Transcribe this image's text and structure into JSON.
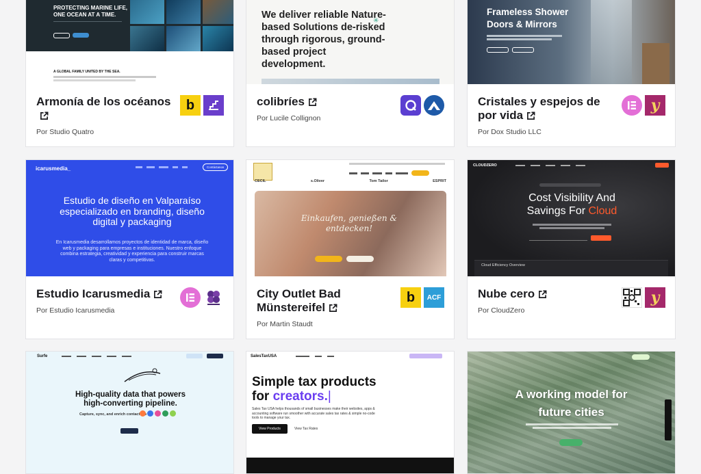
{
  "cards": [
    {
      "title": "Armonía de los océanos",
      "by": "Por Studio Quatro",
      "thumb": {
        "headline_1": "PROTECTING MARINE LIFE,",
        "headline_2": "ONE OCEAN AT A TIME.",
        "subline": "A GLOBAL FAMILY UNITED BY THE SEA."
      },
      "logos": [
        "b",
        "stairs-icon"
      ]
    },
    {
      "title": "colibríes",
      "by": "Por Lucile Collignon",
      "thumb": {
        "headline": "We deliver reliable Nature-based Solutions de-risked through rigorous, ground-based project development."
      },
      "logos": [
        "q-ring-icon",
        "mountain-icon"
      ]
    },
    {
      "title": "Cristales y espejos de por vida",
      "by": "Por Dox Studio LLC",
      "thumb": {
        "headline": "Frameless Shower Doors & Mirrors"
      },
      "logos": [
        "elementor-icon",
        "yoast-icon"
      ]
    },
    {
      "title": "Estudio Icarusmedia",
      "by": "Por Estudio Icarusmedia",
      "thumb": {
        "brand": "icarusmedia_",
        "nav_cta": "Contáctanos",
        "headline": "Estudio de diseño en Valparaíso especializado en branding, diseño digital y packaging",
        "body": "En Icarusmedia desarrollamos proyectos de identidad de marca, diseño web y packaging para empresas e instituciones. Nuestro enfoque combina estrategia, creatividad y experiencia para construir marcas claras y competitivas."
      },
      "logos": [
        "elementor-icon",
        "duplicator-icon"
      ]
    },
    {
      "title": "City Outlet Bad Münstereifel",
      "by": "Por Martin Staudt",
      "thumb": {
        "script_1": "Einkaufen, genießen &",
        "script_2": "entdecken!",
        "brands": [
          "CECIL",
          "s.Oliver",
          "Tom Tailor",
          "ESPRIT"
        ]
      },
      "logos": [
        "b",
        "ACF"
      ]
    },
    {
      "title": "Nube cero",
      "by": "Por CloudZero",
      "thumb": {
        "brand": "CLOUDZERO",
        "headline_1": "Cost Visibility And",
        "headline_2": "Savings For",
        "accent_word": "Cloud",
        "panel_label": "Cloud Efficiency Overview"
      },
      "logos": [
        "qr-icon",
        "yoast-icon"
      ]
    },
    {
      "thumb": {
        "brand": "Surfe",
        "headline_1": "High-quality data that powers",
        "headline_2": "high-converting pipeline.",
        "subline": "Capture, sync, and enrich contacts to"
      }
    },
    {
      "thumb": {
        "brand": "SalesTaxUSA",
        "headline_1": "Simple tax products",
        "headline_2a": "for",
        "headline_2b": "creators.",
        "body": "Sales Tax USA helps thousands of small businesses make their websites, apps & accounting software run smoother with accurate sales tax rates & simple no-code tools to manage your tax.",
        "btn_primary": "View Products",
        "btn_secondary": "View Tax Rates"
      }
    },
    {
      "thumb": {
        "headline_1": "A working model for",
        "headline_2": "future cities"
      }
    }
  ],
  "colors": {
    "accent_blue": "#2d5bff",
    "icarus_blue": "#2f4de8",
    "cloud_orange": "#ff5a2c",
    "tax_purple": "#6a3df0",
    "elementor_pink": "#e36fd6",
    "yoast_purple": "#a4286a",
    "b_yellow": "#f7d010"
  }
}
